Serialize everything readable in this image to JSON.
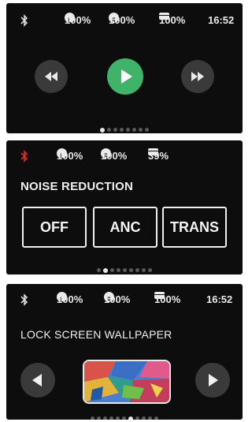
{
  "screens": [
    {
      "status": {
        "left_battery": "100%",
        "right_battery": "100%",
        "case_battery": "100%",
        "time": "16:52"
      },
      "controls": {
        "prev_icon": "rewind-icon",
        "play_icon": "play-icon",
        "next_icon": "fast-forward-icon"
      },
      "page_indicator": {
        "count": 8,
        "active": 1
      }
    },
    {
      "status": {
        "left_battery": "100%",
        "right_battery": "100%",
        "case_battery": "39%"
      },
      "title": "NOISE REDUCTION",
      "modes": [
        "OFF",
        "ANC",
        "TRANS"
      ],
      "page_indicator": {
        "count": 9,
        "active": 2
      }
    },
    {
      "status": {
        "left_battery": "100%",
        "right_battery": "100%",
        "case_battery": "100%",
        "time": "16:52"
      },
      "title": "LOCK SCREEN WALLPAPER",
      "page_indicator": {
        "count": 11,
        "active": 7
      }
    }
  ],
  "colors": {
    "background": "#0d0d0d",
    "play_accent": "#3fb36a",
    "bluetooth_alert": "#d62b2b",
    "text": "#f0f0f0"
  }
}
